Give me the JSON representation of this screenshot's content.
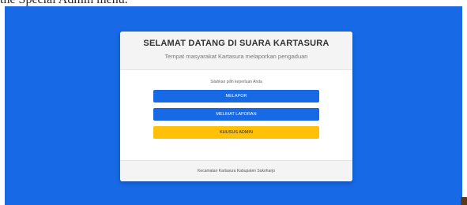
{
  "caption": "the Special Admin menu.",
  "card": {
    "title": "SELAMAT DATANG DI SUARA KARTASURA",
    "subtitle": "Tempat masyarakat Kartasura melaporkan pengaduan",
    "prompt": "Silahkan pilih keperluan Anda",
    "buttons": {
      "report": "MELAPOR",
      "view_reports": "MELIHAT LAPORAN",
      "admin": "KHUSUS ADMIN"
    },
    "footer": "Kecamatan Kartasura Kabupaten Sukoharjo"
  },
  "colors": {
    "background": "#1769e6",
    "primary_button": "#1769e6",
    "admin_button": "#ffc107"
  }
}
